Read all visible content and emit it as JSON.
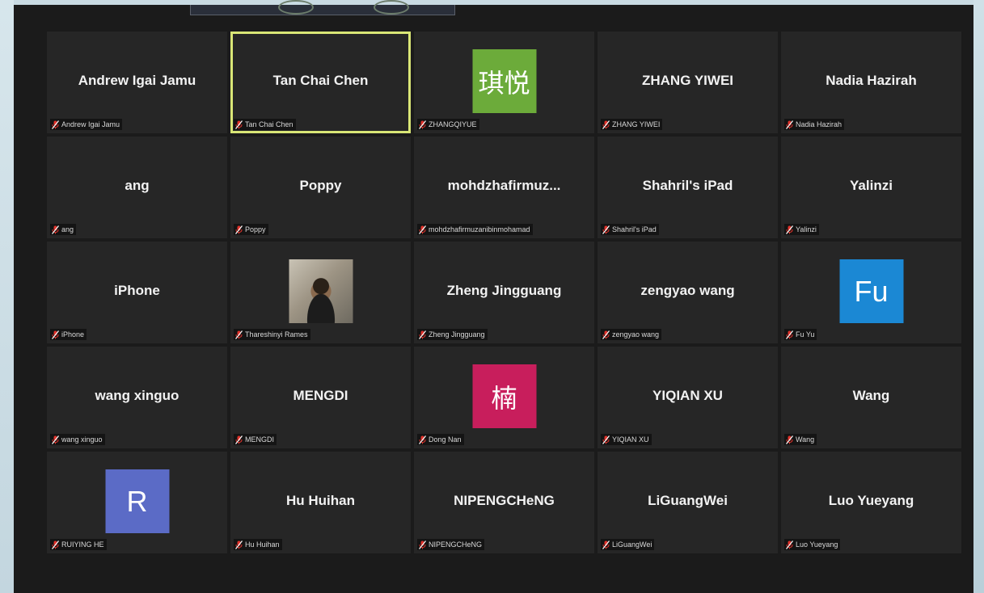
{
  "participants": [
    {
      "display": "Andrew Igai Jamu",
      "caption": "Andrew Igai Jamu",
      "avatar": null
    },
    {
      "display": "Tan Chai Chen",
      "caption": "Tan Chai Chen",
      "avatar": null,
      "active_speaker": true
    },
    {
      "display": "",
      "caption": "ZHANGQIYUE",
      "avatar": {
        "type": "text",
        "text": "琪悦",
        "color": "#6cab3a",
        "style": "cjk"
      }
    },
    {
      "display": "ZHANG YIWEI",
      "caption": "ZHANG YIWEI",
      "avatar": null
    },
    {
      "display": "Nadia Hazirah",
      "caption": "Nadia Hazirah",
      "avatar": null
    },
    {
      "display": "ang",
      "caption": "ang",
      "avatar": null
    },
    {
      "display": "Poppy",
      "caption": "Poppy",
      "avatar": null
    },
    {
      "display": "mohdzhafirmuz...",
      "caption": "mohdzhafirmuzanibinmohamad",
      "avatar": null
    },
    {
      "display": "Shahril's iPad",
      "caption": "Shahril's iPad",
      "avatar": null
    },
    {
      "display": "Yalinzi",
      "caption": "Yalinzi",
      "avatar": null
    },
    {
      "display": "iPhone",
      "caption": "iPhone",
      "avatar": null
    },
    {
      "display": "",
      "caption": "Thareshinyi Rames",
      "avatar": {
        "type": "photo"
      }
    },
    {
      "display": "Zheng Jingguang",
      "caption": "Zheng Jingguang",
      "avatar": null
    },
    {
      "display": "zengyao wang",
      "caption": "zengyao wang",
      "avatar": null
    },
    {
      "display": "",
      "caption": "Fu Yu",
      "avatar": {
        "type": "text",
        "text": "Fu",
        "color": "#1b88d4",
        "style": "latin"
      }
    },
    {
      "display": "wang xinguo",
      "caption": "wang xinguo",
      "avatar": null
    },
    {
      "display": "MENGDI",
      "caption": "MENGDI",
      "avatar": null
    },
    {
      "display": "",
      "caption": "Dong Nan",
      "avatar": {
        "type": "text",
        "text": "楠",
        "color": "#c81e5c",
        "style": "cjk"
      }
    },
    {
      "display": "YIQIAN XU",
      "caption": "YIQIAN XU",
      "avatar": null
    },
    {
      "display": "Wang",
      "caption": "Wang",
      "avatar": null
    },
    {
      "display": "",
      "caption": "RUIYING HE",
      "avatar": {
        "type": "text",
        "text": "R",
        "color": "#5b6bc6",
        "style": "latin"
      }
    },
    {
      "display": "Hu Huihan",
      "caption": "Hu Huihan",
      "avatar": null
    },
    {
      "display": "NIPENGCHeNG",
      "caption": "NIPENGCHeNG",
      "avatar": null
    },
    {
      "display": "LiGuangWei",
      "caption": "LiGuangWei",
      "avatar": null
    },
    {
      "display": "Luo Yueyang",
      "caption": "Luo Yueyang",
      "avatar": null
    }
  ],
  "icons": {
    "caption_status": "mic-muted-icon"
  },
  "colors": {
    "active_speaker_border": "#d9e676",
    "tile_bg": "#262626",
    "muted_icon": "#e0322b"
  }
}
